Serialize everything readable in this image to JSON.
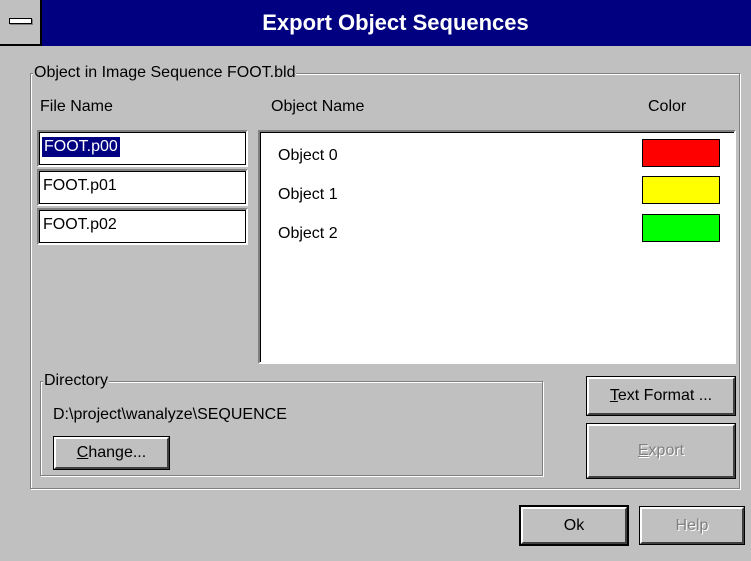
{
  "window": {
    "title": "Export Object Sequences"
  },
  "group": {
    "label": "Object in Image Sequence FOOT.bld"
  },
  "headers": {
    "file_name": "File Name",
    "object_name": "Object Name",
    "color": "Color"
  },
  "files": [
    {
      "value": "FOOT.p00",
      "selected": true
    },
    {
      "value": "FOOT.p01",
      "selected": false
    },
    {
      "value": "FOOT.p02",
      "selected": false
    }
  ],
  "objects": [
    {
      "name": "Object 0",
      "color": "#ff0000"
    },
    {
      "name": "Object 1",
      "color": "#ffff00"
    },
    {
      "name": "Object 2",
      "color": "#00ff00"
    }
  ],
  "directory": {
    "label": "Directory",
    "path": "D:\\project\\wanalyze\\SEQUENCE",
    "change_mnemonic": "C",
    "change_rest": "hange..."
  },
  "buttons": {
    "text_format_mnemonic": "T",
    "text_format_rest": "ext Format ...",
    "export_mnemonic": "E",
    "export_rest": "xport",
    "ok": "Ok",
    "help": "Help"
  }
}
